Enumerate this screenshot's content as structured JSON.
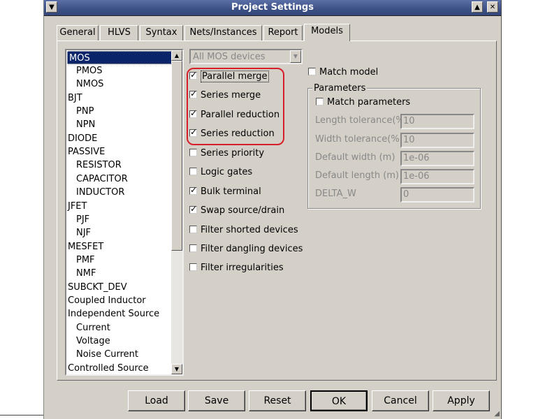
{
  "window": {
    "title": "Project Settings"
  },
  "tabs": [
    "General",
    "HLVS",
    "Syntax",
    "Nets/Instances",
    "Report",
    "Models"
  ],
  "device_list": [
    "MOS",
    "PMOS",
    "NMOS",
    "BJT",
    "PNP",
    "NPN",
    "DIODE",
    "PASSIVE",
    "RESISTOR",
    "CAPACITOR",
    "INDUCTOR",
    "JFET",
    "PJF",
    "NJF",
    "MESFET",
    "PMF",
    "NMF",
    "SUBCKT_DEV",
    "Coupled Inductor",
    "Independent Source",
    "Current",
    "Voltage",
    "Noise Current",
    "Controlled Source"
  ],
  "selected_device": "MOS",
  "device_filter": "All MOS devices",
  "options": [
    {
      "label": "Parallel merge",
      "checked": true
    },
    {
      "label": "Series merge",
      "checked": true
    },
    {
      "label": "Parallel reduction",
      "checked": true
    },
    {
      "label": "Series reduction",
      "checked": true
    },
    {
      "label": "Series priority",
      "checked": false
    },
    {
      "label": "Logic gates",
      "checked": false
    },
    {
      "label": "Bulk terminal",
      "checked": true
    },
    {
      "label": "Swap source/drain",
      "checked": true
    },
    {
      "label": "Filter shorted devices",
      "checked": false
    },
    {
      "label": "Filter dangling devices",
      "checked": false
    },
    {
      "label": "Filter irregularities",
      "checked": false
    }
  ],
  "match_model": {
    "label": "Match model",
    "checked": false
  },
  "parameters": {
    "title": "Parameters",
    "match_parameters": {
      "label": "Match parameters",
      "checked": false
    },
    "fields": [
      {
        "label": "Length tolerance(%)",
        "value": "10"
      },
      {
        "label": "Width tolerance(%)",
        "value": "10"
      },
      {
        "label": "Default width (m)",
        "value": "1e-06"
      },
      {
        "label": "Default length (m)",
        "value": "1e-06"
      },
      {
        "label": "DELTA_W",
        "value": "0"
      }
    ]
  },
  "buttons": {
    "load": "Load",
    "save": "Save",
    "reset": "Reset",
    "ok": "OK",
    "cancel": "Cancel",
    "apply": "Apply"
  },
  "colors": {
    "selection": "#0a246a",
    "highlight_box": "#d81e2a",
    "titlebar": "#3d5186"
  }
}
